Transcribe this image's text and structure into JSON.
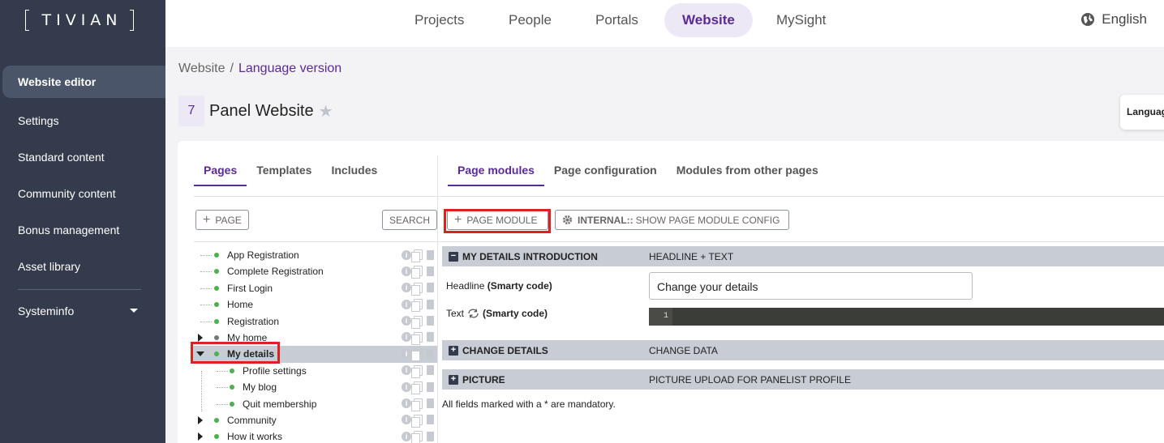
{
  "brand": {
    "logo_text": "TIVIAN"
  },
  "sidebar": {
    "items": [
      {
        "label": "Website editor",
        "active": true
      },
      {
        "label": "Settings"
      },
      {
        "label": "Standard content"
      },
      {
        "label": "Community content"
      },
      {
        "label": "Bonus management"
      },
      {
        "label": "Asset library"
      }
    ],
    "systeminfo": "Systeminfo"
  },
  "topnav": {
    "items": [
      "Projects",
      "People",
      "Portals",
      "Website",
      "MySight"
    ],
    "active": "Website",
    "language": "English"
  },
  "breadcrumb": {
    "root": "Website",
    "separator": "/",
    "current": "Language version"
  },
  "title": {
    "number": "7",
    "name": "Panel Website"
  },
  "language_card": "Languag",
  "left_panel": {
    "tabs": [
      "Pages",
      "Templates",
      "Includes"
    ],
    "add_page": "PAGE",
    "search": "SEARCH",
    "tree": [
      {
        "label": "App Registration",
        "level": 0
      },
      {
        "label": "Complete Registration",
        "level": 0
      },
      {
        "label": "First Login",
        "level": 0
      },
      {
        "label": "Home",
        "level": 0
      },
      {
        "label": "Registration",
        "level": 0
      },
      {
        "label": "My home",
        "level": 0
      },
      {
        "label": "My details",
        "level": 0
      },
      {
        "label": "Profile settings",
        "level": 1
      },
      {
        "label": "My blog",
        "level": 1
      },
      {
        "label": "Quit membership",
        "level": 1
      },
      {
        "label": "Community",
        "level": 0
      },
      {
        "label": "How it works",
        "level": 0
      }
    ]
  },
  "right_panel": {
    "tabs": [
      "Page modules",
      "Page configuration",
      "Modules from other pages"
    ],
    "add_module": "PAGE MODULE",
    "internal_prefix": "INTERNAL::",
    "internal_rest": "SHOW PAGE MODULE CONFIG",
    "modules": [
      {
        "name": "MY DETAILS INTRODUCTION",
        "type": "HEADLINE + TEXT",
        "expanded": true
      },
      {
        "name": "CHANGE DETAILS",
        "type": "CHANGE DATA",
        "expanded": false
      },
      {
        "name": "PICTURE",
        "type": "PICTURE UPLOAD FOR PANELIST PROFILE",
        "expanded": false
      }
    ],
    "headline_label": "Headline",
    "headline_smarty": "(Smarty code)",
    "headline_value": "Change your details",
    "text_label": "Text",
    "text_smarty": "(Smarty code)",
    "line_number": "1",
    "mandatory_note": "All fields marked with a * are mandatory."
  }
}
